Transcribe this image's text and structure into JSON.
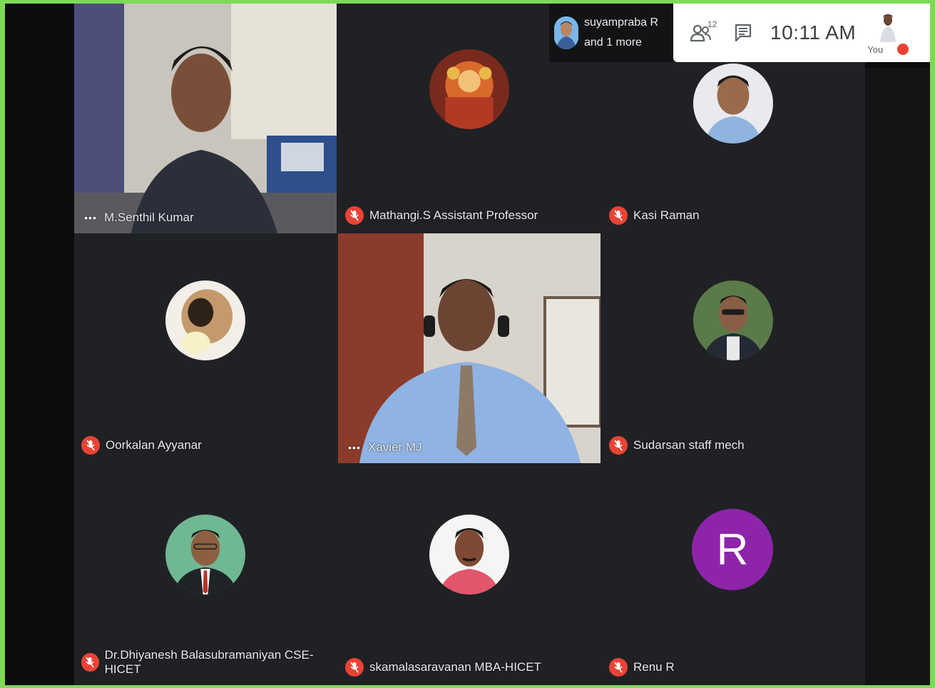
{
  "presenter_chip": {
    "line1": "suyampraba R",
    "line2": "and 1 more"
  },
  "toolbar": {
    "participants_icon": "people-icon",
    "participants_count": "12",
    "chat_icon": "chat-icon",
    "clock": "10:11 AM",
    "self_label": "You"
  },
  "colors": {
    "mute_red": "#ea4335",
    "tile_bg": "#202124",
    "letter_avatar": "#8e24aa",
    "outer_border": "#7ed957"
  },
  "participants": [
    {
      "name": "M.Senthil Kumar",
      "status": "more-options",
      "kind": "video"
    },
    {
      "name": "Mathangi.S Assistant Professor",
      "status": "muted",
      "kind": "avatar"
    },
    {
      "name": "Kasi Raman",
      "status": "muted",
      "kind": "avatar"
    },
    {
      "name": "Oorkalan Ayyanar",
      "status": "muted",
      "kind": "avatar"
    },
    {
      "name": "Xavier MJ",
      "status": "more-options",
      "kind": "video"
    },
    {
      "name": "Sudarsan staff mech",
      "status": "muted",
      "kind": "avatar"
    },
    {
      "name": "Dr.Dhiyanesh Balasubramaniyan CSE-HICET",
      "status": "muted",
      "kind": "avatar"
    },
    {
      "name": "skamalasaravanan MBA-HICET",
      "status": "muted",
      "kind": "avatar"
    },
    {
      "name": "Renu R",
      "status": "muted",
      "kind": "letter",
      "letter": "R"
    }
  ]
}
